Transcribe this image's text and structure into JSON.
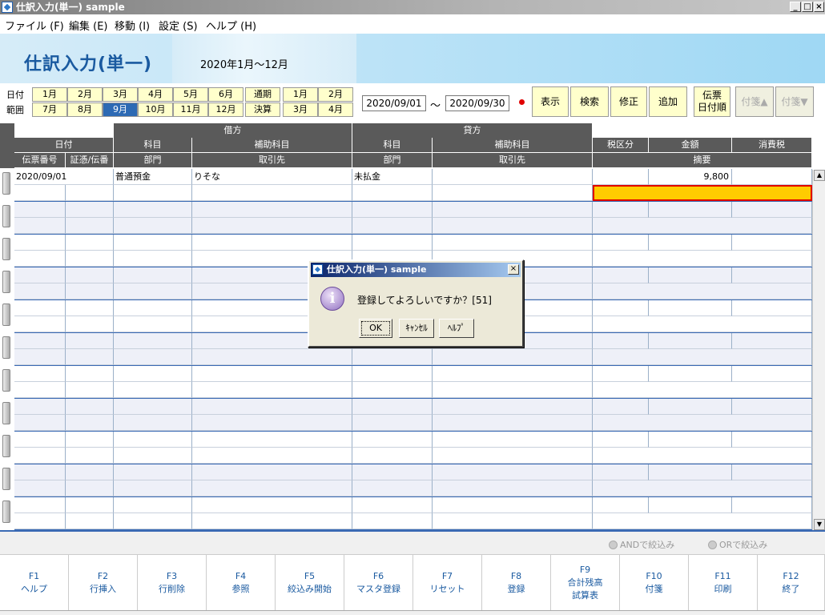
{
  "window": {
    "title": "仕訳入力(単一) sample",
    "minimize": "_",
    "maximize": "□",
    "close": "×"
  },
  "menu": [
    {
      "label": "ファイル (F)"
    },
    {
      "label": "編集 (E)"
    },
    {
      "label": "移動 (I)"
    },
    {
      "label": "設定 (S)"
    },
    {
      "label": "ヘルプ (H)"
    }
  ],
  "header": {
    "title": "仕訳入力(単一)",
    "period": "2020年1月～12月"
  },
  "toolbar": {
    "date_label": "日付",
    "range_label": "範囲",
    "months_row1": [
      "1月",
      "2月",
      "3月",
      "4月",
      "5月",
      "6月"
    ],
    "months_row2": [
      "7月",
      "8月",
      "9月",
      "10月",
      "11月",
      "12月"
    ],
    "selected_month": "9月",
    "period_btn1": "通期",
    "period_btn2": "決算",
    "q_row1": [
      "1月",
      "2月"
    ],
    "q_row2": [
      "3月",
      "4月"
    ],
    "date_from": "2020/09/01",
    "tilde": "～",
    "date_to": "2020/09/30",
    "status_dot_color": "#e00000",
    "btn_show": "表示",
    "btn_search": "検索",
    "btn_edit": "修正",
    "btn_add": "追加",
    "btn_sort_line1": "伝票",
    "btn_sort_line2": "日付順",
    "btn_tag_up": "付箋▲",
    "btn_tag_down": "付箋▼"
  },
  "grid": {
    "header_debit": "借方",
    "header_credit": "貸方",
    "col_date": "日付",
    "col_slip": "伝票番号",
    "col_voucher": "証憑/伝番",
    "col_debit_account": "科目",
    "col_debit_sub": "補助科目",
    "col_debit_dept": "部門",
    "col_debit_partner": "取引先",
    "col_credit_account": "科目",
    "col_credit_sub": "補助科目",
    "col_credit_dept": "部門",
    "col_credit_partner": "取引先",
    "col_tax": "税区分",
    "col_amount": "金額",
    "col_ctax": "消費税",
    "col_memo": "摘要",
    "rows": [
      {
        "date": "2020/09/01",
        "debit_account": "普通預金",
        "debit_sub": "りそな",
        "credit_account": "未払金",
        "amount": "9,800"
      }
    ],
    "highlight_color": "#ffcc00"
  },
  "filters": {
    "and_label": "ANDで絞込み",
    "or_label": "ORで絞込み"
  },
  "fkeys": [
    {
      "key": "F1",
      "label": "ヘルプ"
    },
    {
      "key": "F2",
      "label": "行挿入"
    },
    {
      "key": "F3",
      "label": "行削除"
    },
    {
      "key": "F4",
      "label": "参照"
    },
    {
      "key": "F5",
      "label": "絞込み開始"
    },
    {
      "key": "F6",
      "label": "マスタ登録"
    },
    {
      "key": "F7",
      "label": "リセット"
    },
    {
      "key": "F8",
      "label": "登録"
    },
    {
      "key": "F9",
      "label": "合計残高",
      "label2": "試算表"
    },
    {
      "key": "F10",
      "label": "付箋"
    },
    {
      "key": "F11",
      "label": "印刷"
    },
    {
      "key": "F12",
      "label": "終了"
    }
  ],
  "dialog": {
    "title": "仕訳入力(単一) sample",
    "info_glyph": "i",
    "message": "登録してよろしいですか？[51]",
    "ok": "OK",
    "cancel": "ｷｬﾝｾﾙ",
    "help": "ﾍﾙﾌﾟ",
    "close": "×"
  }
}
